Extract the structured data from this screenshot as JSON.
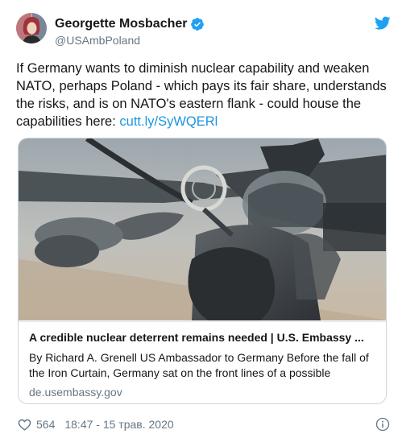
{
  "author": {
    "display_name": "Georgette Mosbacher",
    "handle": "@USAmbPoland",
    "verified": true
  },
  "tweet": {
    "text": "If Germany wants to diminish nuclear capability and weaken NATO, perhaps Poland - which pays its fair share, understands the risks, and is on NATO's eastern flank - could house the capabilities here: ",
    "link": "cutt.ly/SyWQERl"
  },
  "card": {
    "title": "A credible nuclear deterrent remains needed | U.S. Embassy ...",
    "description": "By Richard A. Grenell US Ambassador to Germany   Before the fall of the Iron Curtain, Germany sat on the front lines of a possible",
    "domain": "de.usembassy.gov"
  },
  "footer": {
    "likes": "564",
    "timestamp": "18:47 - 15 трав. 2020"
  },
  "icons": {
    "verified": "verified-badge-icon",
    "bird": "twitter-bird-icon",
    "heart": "heart-icon",
    "info": "info-icon"
  },
  "colors": {
    "brand": "#1da1f2",
    "link": "#1b95e0",
    "muted": "#657786",
    "border": "#ccd6dd"
  }
}
